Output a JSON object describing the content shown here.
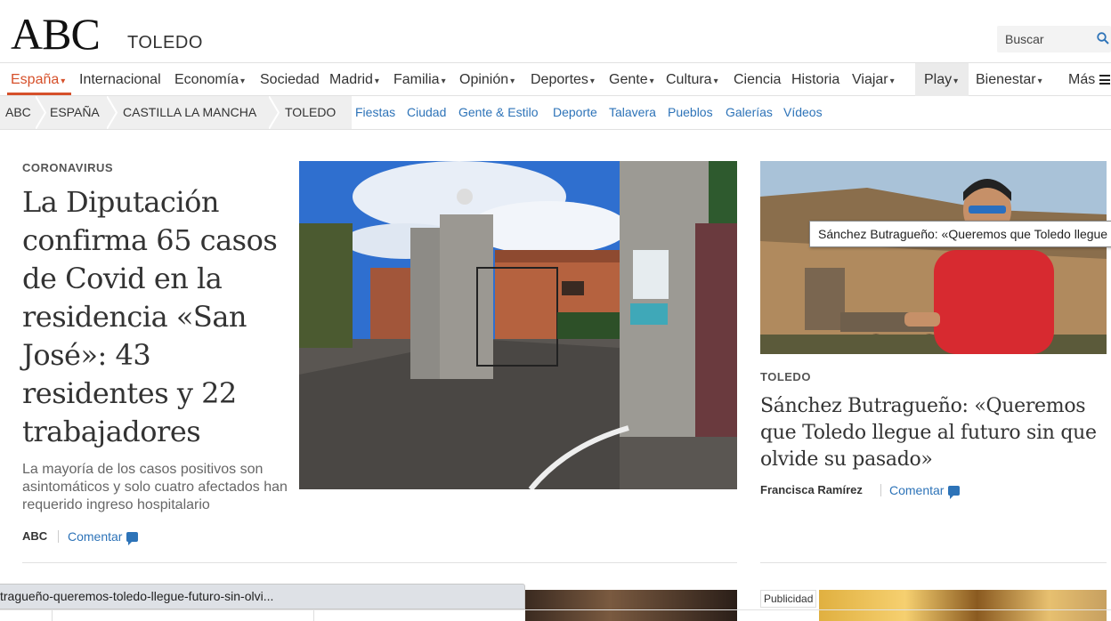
{
  "header": {
    "logo": "ABC",
    "section": "TOLEDO",
    "search_placeholder": "Buscar"
  },
  "nav": {
    "items": [
      {
        "label": "España",
        "caret": true
      },
      {
        "label": "Internacional",
        "caret": false
      },
      {
        "label": "Economía",
        "caret": true
      },
      {
        "label": "Sociedad",
        "caret": false
      },
      {
        "label": "Madrid",
        "caret": true
      },
      {
        "label": "Familia",
        "caret": true
      },
      {
        "label": "Opinión",
        "caret": true
      },
      {
        "label": "Deportes",
        "caret": true
      },
      {
        "label": "Gente",
        "caret": true
      },
      {
        "label": "Cultura",
        "caret": true
      },
      {
        "label": "Ciencia",
        "caret": false
      },
      {
        "label": "Historia",
        "caret": false
      },
      {
        "label": "Viajar",
        "caret": true
      },
      {
        "label": "Play",
        "caret": true
      },
      {
        "label": "Bienestar",
        "caret": true
      },
      {
        "label": "Más",
        "caret": false
      }
    ],
    "caret_glyph": "▾"
  },
  "subnav": {
    "breadcrumbs": [
      "ABC",
      "ESPAÑA",
      "CASTILLA LA MANCHA",
      "TOLEDO"
    ],
    "links": [
      "Fiestas",
      "Ciudad",
      "Gente & Estilo",
      "Deporte",
      "Talavera",
      "Pueblos",
      "Galerías",
      "Vídeos"
    ]
  },
  "lead": {
    "kicker": "CORONAVIRUS",
    "headline": "La Diputación confirma 65 casos de Covid en la residencia «San José»: 43 residentes y 22 trabajadores",
    "summary": "La mayoría de los casos positivos son asintomáticos y solo cuatro afectados han requerido ingreso hospitalario",
    "author": "ABC",
    "comment": "Comentar"
  },
  "side": {
    "kicker": "TOLEDO",
    "headline": "Sánchez Butragueño: «Queremos que Toledo llegue al futuro sin que olvide su pasado»",
    "author": "Francisca Ramírez",
    "comment": "Comentar",
    "tooltip": "Sánchez Butragueño: «Queremos que Toledo llegue al futuro sin que olvide su pasado»"
  },
  "ad": {
    "label": "Publicidad"
  },
  "status_bar": {
    "url": "tragueño-queremos-toledo-llegue-futuro-sin-olvi..."
  },
  "colors": {
    "accent": "#d6502a",
    "link": "#2d73b8"
  }
}
